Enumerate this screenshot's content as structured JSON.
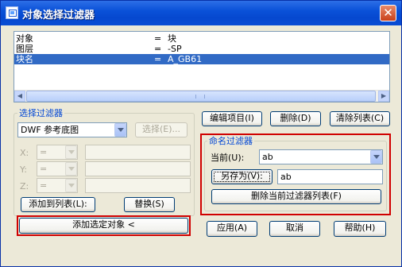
{
  "window": {
    "title": "对象选择过滤器",
    "close_glyph": "✕"
  },
  "filter_list": {
    "rows": [
      {
        "name": "对象",
        "op": "=",
        "value": "块"
      },
      {
        "name": "图层",
        "op": "=",
        "value": "-SP"
      },
      {
        "name": "块名",
        "op": "=",
        "value": "A_GB61"
      }
    ],
    "selected_index": 2,
    "scroll_left_glyph": "◀",
    "scroll_right_glyph": "▶"
  },
  "select_filter": {
    "title": "选择过滤器",
    "type_value": "DWF 参考底图",
    "select_button": "选择(E)...",
    "x_label": "X:",
    "y_label": "Y:",
    "z_label": "Z:",
    "op_value": "=",
    "add_to_list_button": "添加到列表(L):",
    "replace_button": "替换(S)",
    "add_selected_button": "添加选定对象 <"
  },
  "actions": {
    "edit_item": "编辑项目(I)",
    "delete": "删除(D)",
    "clear_list": "清除列表(C)"
  },
  "named_filters": {
    "title": "命名过滤器",
    "current_label": "当前(U):",
    "current_value": "ab",
    "save_as_button": "另存为(V):",
    "save_as_value": "ab",
    "delete_current_button": "删除当前过滤器列表(F)"
  },
  "footer": {
    "apply": "应用(A)",
    "cancel": "取消",
    "help": "帮助(H)"
  },
  "colors": {
    "highlight": "#d00000",
    "title_accent": "#0046d5",
    "selection": "#316ac5"
  }
}
